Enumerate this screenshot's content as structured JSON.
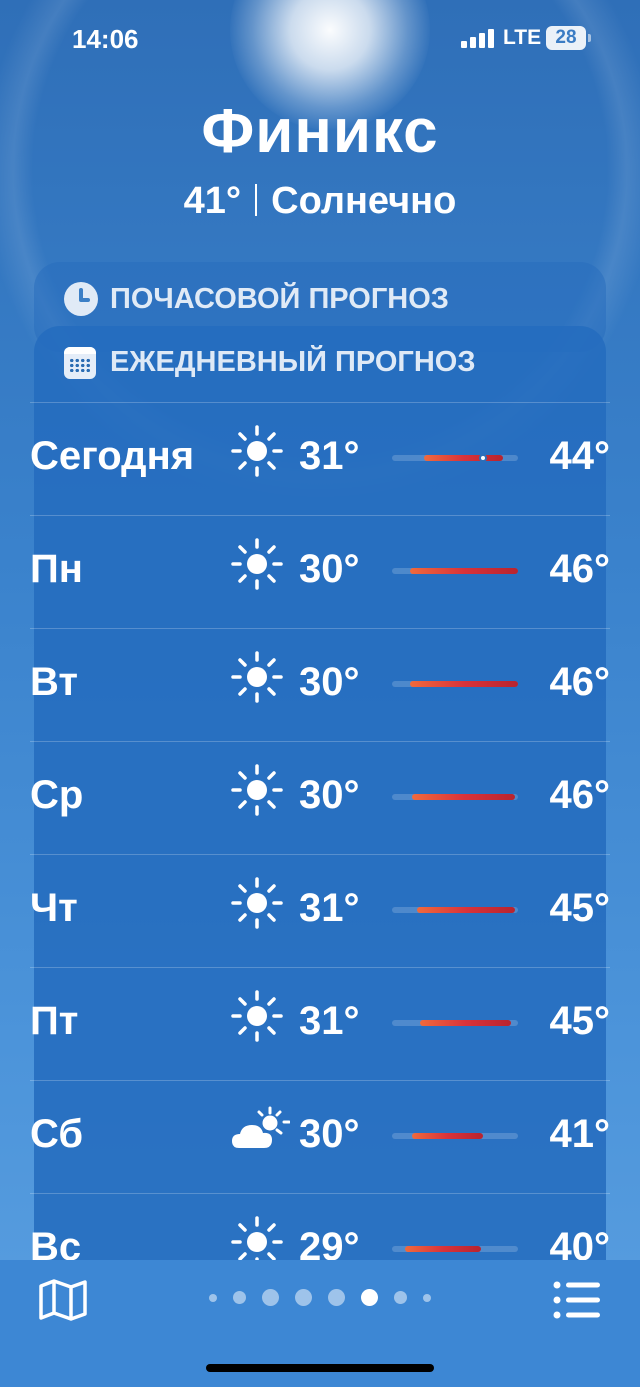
{
  "status_bar": {
    "time": "14:06",
    "network": "LTE",
    "battery": "28"
  },
  "location": {
    "city": "Финикс",
    "temperature": "41°",
    "condition": "Солнечно"
  },
  "hourly": {
    "title": "ПОЧАСОВОЙ ПРОГНОЗ",
    "icon": "clock-icon"
  },
  "daily": {
    "title": "ЕЖЕДНЕВНЫЙ ПРОГНОЗ",
    "icon": "calendar-icon",
    "days": [
      {
        "day": "Сегодня",
        "icon": "sun-icon",
        "low": "31°",
        "high": "44°",
        "range_start": 0.25,
        "range_end": 0.88,
        "current": 0.72
      },
      {
        "day": "Пн",
        "icon": "sun-icon",
        "low": "30°",
        "high": "46°",
        "range_start": 0.14,
        "range_end": 1.0
      },
      {
        "day": "Вт",
        "icon": "sun-icon",
        "low": "30°",
        "high": "46°",
        "range_start": 0.14,
        "range_end": 1.0
      },
      {
        "day": "Ср",
        "icon": "sun-icon",
        "low": "30°",
        "high": "46°",
        "range_start": 0.16,
        "range_end": 0.98
      },
      {
        "day": "Чт",
        "icon": "sun-icon",
        "low": "31°",
        "high": "45°",
        "range_start": 0.2,
        "range_end": 0.98
      },
      {
        "day": "Пт",
        "icon": "sun-icon",
        "low": "31°",
        "high": "45°",
        "range_start": 0.22,
        "range_end": 0.94
      },
      {
        "day": "Сб",
        "icon": "partly-cloudy-icon",
        "low": "30°",
        "high": "41°",
        "range_start": 0.16,
        "range_end": 0.72
      },
      {
        "day": "Вс",
        "icon": "sun-icon",
        "low": "29°",
        "high": "40°",
        "range_start": 0.1,
        "range_end": 0.7
      }
    ]
  },
  "pager": {
    "count": 8,
    "active": 5
  },
  "toolbar": {
    "map_icon": "map-icon",
    "list_icon": "list-icon"
  },
  "colors": {
    "bar_start": "#f06a3c",
    "bar_end": "#b8242f",
    "background": "#3a82cc"
  }
}
